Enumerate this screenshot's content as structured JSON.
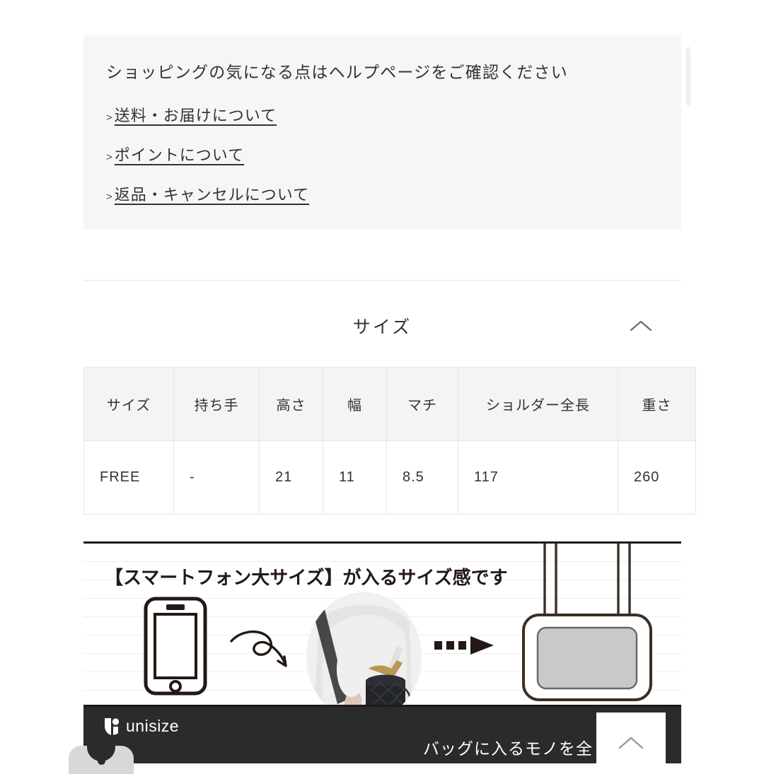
{
  "help": {
    "title": "ショッピングの気になる点はヘルプページをご確認ください",
    "arrow_marker": ">",
    "links": [
      {
        "label": "送料・お届けについて"
      },
      {
        "label": "ポイントについて"
      },
      {
        "label": "返品・キャンセルについて"
      }
    ]
  },
  "size_section": {
    "title": "サイズ",
    "collapse_icon": "chevron-up-icon",
    "table": {
      "headers": [
        "サイズ",
        "持ち手",
        "高さ",
        "幅",
        "マチ",
        "ショルダー全長",
        "重さ"
      ],
      "rows": [
        [
          "FREE",
          "-",
          "21",
          "11",
          "8.5",
          "117",
          "260"
        ]
      ]
    }
  },
  "promo_banner": {
    "title": "【スマートフォン大サイズ】が入るサイズ感です",
    "phone_icon": "smartphone-icon",
    "curve_arrow_icon": "curved-arrow-icon",
    "photo_icon": "model-with-bag-photo",
    "dash_arrow_icon": "dashed-arrow-icon",
    "bag_icon": "shoulder-bag-icon"
  },
  "unisize": {
    "brand": "unisize",
    "logo_icon": "unisize-shield-icon",
    "message": "バッグに入るモノを全"
  },
  "scroll_top": {
    "icon": "chevron-up-icon"
  },
  "colors": {
    "panel_bg": "#f6f6f6",
    "table_header_bg": "#f4f4f4",
    "border": "#e6e6e6",
    "dark_bar": "#2b2b2b",
    "ink": "#231815",
    "text": "#333333"
  }
}
